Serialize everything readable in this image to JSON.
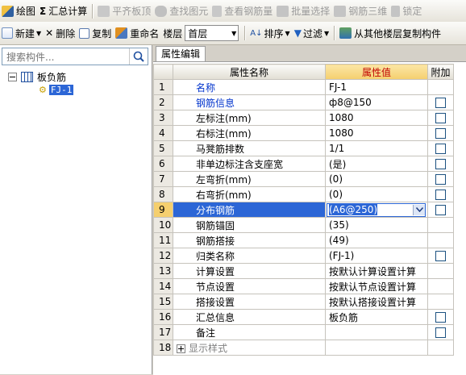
{
  "toolbar1": [
    {
      "label": "绘图",
      "icon": "pencil-icon",
      "disabled": false
    },
    {
      "label": "汇总计算",
      "icon": "sigma-icon",
      "disabled": false
    },
    {
      "label": "平齐板顶",
      "icon": "align-slab-icon",
      "disabled": true
    },
    {
      "label": "查找图元",
      "icon": "binoculars-icon",
      "disabled": true
    },
    {
      "label": "查看钢筋量",
      "icon": "rebar-view-icon",
      "disabled": true
    },
    {
      "label": "批量选择",
      "icon": "batch-select-icon",
      "disabled": true
    },
    {
      "label": "钢筋三维",
      "icon": "rebar-3d-icon",
      "disabled": true
    },
    {
      "label": "锁定",
      "icon": "lock-icon",
      "disabled": true
    }
  ],
  "toolbar2": {
    "new_label": "新建",
    "delete_label": "删除",
    "copy_label": "复制",
    "rename_label": "重命名",
    "floor_label": "楼层",
    "floor_value": "首层",
    "sort_label": "排序",
    "filter_label": "过滤",
    "copy_from_label": "从其他楼层复制构件"
  },
  "search": {
    "placeholder": "搜索构件..."
  },
  "tree": {
    "root": "板负筋",
    "child": "FJ-1"
  },
  "tab_label": "属性编辑",
  "grid": {
    "headers": {
      "name": "属性名称",
      "value": "属性值",
      "add": "附加"
    },
    "rows": [
      {
        "no": "1",
        "name": "名称",
        "value": "FJ-1",
        "blue": true,
        "cb": false
      },
      {
        "no": "2",
        "name": "钢筋信息",
        "value": "ф8@150",
        "blue": true,
        "cb": true
      },
      {
        "no": "3",
        "name": "左标注(mm)",
        "value": "1080",
        "blue": false,
        "cb": true
      },
      {
        "no": "4",
        "name": "右标注(mm)",
        "value": "1080",
        "blue": false,
        "cb": true
      },
      {
        "no": "5",
        "name": "马凳筋排数",
        "value": "1/1",
        "blue": false,
        "cb": true
      },
      {
        "no": "6",
        "name": "非单边标注含支座宽",
        "value": "(是)",
        "blue": false,
        "cb": true
      },
      {
        "no": "7",
        "name": "左弯折(mm)",
        "value": "(0)",
        "blue": false,
        "cb": true
      },
      {
        "no": "8",
        "name": "右弯折(mm)",
        "value": "(0)",
        "blue": false,
        "cb": true
      },
      {
        "no": "9",
        "name": "分布钢筋",
        "value": "(A6@250)",
        "blue": false,
        "cb": true,
        "selected": true
      },
      {
        "no": "10",
        "name": "钢筋锚固",
        "value": "(35)",
        "blue": false,
        "cb": false
      },
      {
        "no": "11",
        "name": "钢筋搭接",
        "value": "(49)",
        "blue": false,
        "cb": false
      },
      {
        "no": "12",
        "name": "归类名称",
        "value": "(FJ-1)",
        "blue": false,
        "cb": true
      },
      {
        "no": "13",
        "name": "计算设置",
        "value": "按默认计算设置计算",
        "blue": false,
        "cb": false
      },
      {
        "no": "14",
        "name": "节点设置",
        "value": "按默认节点设置计算",
        "blue": false,
        "cb": false
      },
      {
        "no": "15",
        "name": "搭接设置",
        "value": "按默认搭接设置计算",
        "blue": false,
        "cb": false
      },
      {
        "no": "16",
        "name": "汇总信息",
        "value": "板负筋",
        "blue": false,
        "cb": true
      },
      {
        "no": "17",
        "name": "备注",
        "value": "",
        "blue": false,
        "cb": true
      },
      {
        "no": "18",
        "name": "显示样式",
        "value": "",
        "blue": false,
        "cb": false,
        "expander": true
      }
    ]
  },
  "colors": {
    "selection": "#2c66d6",
    "header_value_bg": "#f5cf6e",
    "link_blue": "#0033cc"
  }
}
